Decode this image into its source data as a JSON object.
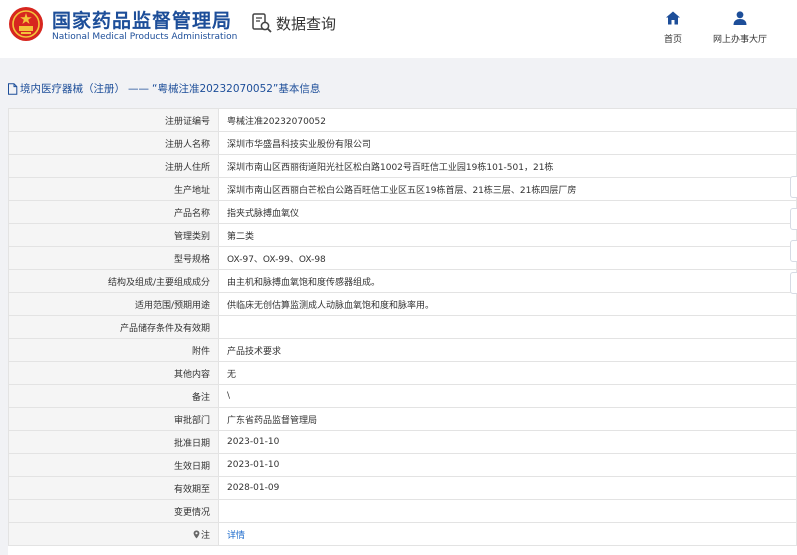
{
  "header": {
    "org_cn": "国家药品监督管理局",
    "org_en": "National Medical Products Administration",
    "search_title": "数据查询",
    "nav": [
      {
        "label": "首页",
        "icon": "home-icon"
      },
      {
        "label": "网上办事大厅",
        "icon": "user-icon"
      }
    ]
  },
  "breadcrumb": {
    "section": "境内医疗器械（注册）",
    "separator": "——",
    "record": "“粤械注准20232070052”",
    "suffix": " 基本信息"
  },
  "rows": [
    {
      "label": "注册证编号",
      "value": "粤械注准20232070052"
    },
    {
      "label": "注册人名称",
      "value": "深圳市华盛昌科技实业股份有限公司"
    },
    {
      "label": "注册人住所",
      "value": "深圳市南山区西丽街道阳光社区松白路1002号百旺信工业园19栋101-501，21栋"
    },
    {
      "label": "生产地址",
      "value": "深圳市南山区西丽白芒松白公路百旺信工业区五区19栋首层、21栋三层、21栋四层厂房"
    },
    {
      "label": "产品名称",
      "value": "指夹式脉搏血氧仪"
    },
    {
      "label": "管理类别",
      "value": "第二类"
    },
    {
      "label": "型号规格",
      "value": "OX-97、OX-99、OX-98"
    },
    {
      "label": "结构及组成/主要组成成分",
      "value": "由主机和脉搏血氧饱和度传感器组成。"
    },
    {
      "label": "适用范围/预期用途",
      "value": "供临床无创估算监测成人动脉血氧饱和度和脉率用。"
    },
    {
      "label": "产品储存条件及有效期",
      "value": ""
    },
    {
      "label": "附件",
      "value": "产品技术要求"
    },
    {
      "label": "其他内容",
      "value": "无"
    },
    {
      "label": "备注",
      "value": "\\"
    },
    {
      "label": "审批部门",
      "value": "广东省药品监督管理局"
    },
    {
      "label": "批准日期",
      "value": "2023-01-10"
    },
    {
      "label": "生效日期",
      "value": "2023-01-10"
    },
    {
      "label": "有效期至",
      "value": "2028-01-09"
    },
    {
      "label": "变更情况",
      "value": ""
    }
  ],
  "note_row": {
    "label": "注",
    "value": "详情"
  },
  "colors": {
    "brand_blue": "#1d4e99",
    "link_blue": "#1d6bcc",
    "emblem_red": "#d7261f",
    "band_gray": "#f1f2f5"
  }
}
